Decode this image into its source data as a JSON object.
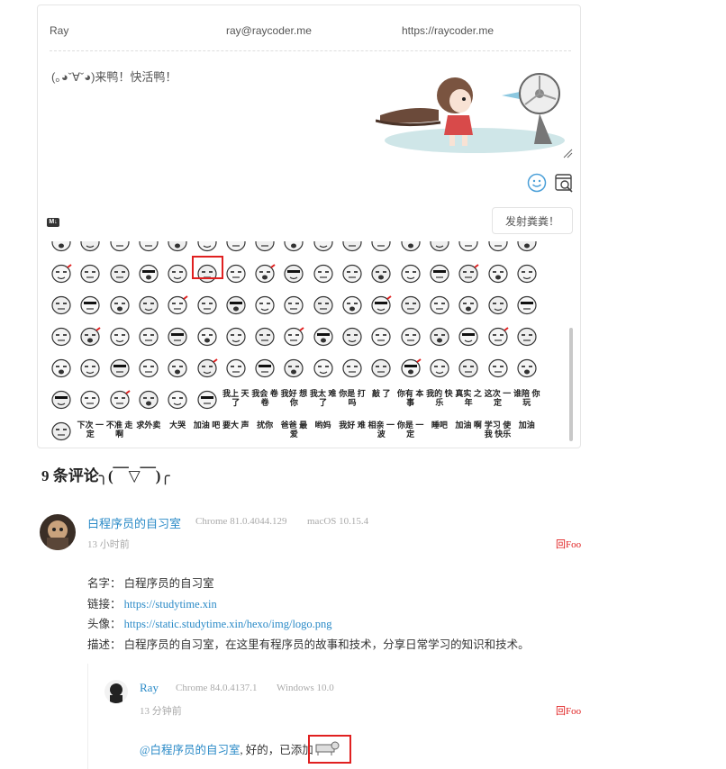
{
  "form": {
    "nick": "Ray",
    "mail": "ray@raycoder.me",
    "link": "https://raycoder.me",
    "content_text": "(｡◕ˇ∀ˇ◕)来鸭！快活鸭！",
    "submit_label": "发射粪粪！",
    "markdown_badge": "M↓"
  },
  "emoji_text_items": [
    "我上\n天了",
    "我会\n卷卷",
    "我好\n想你",
    "我太\n难了",
    "你是\n打吗",
    "敲\n了",
    "你有\n本事",
    "我的\n快乐",
    "真实\n之年",
    "这次\n一定",
    "谁陪\n你玩",
    "下次\n一定",
    "不准\n走啊",
    "求外卖",
    "大哭",
    "加油\n吧",
    "要大\n声",
    "扰你",
    "爸爸\n最爱",
    "哟妈",
    "我好\n难",
    "相亲\n一波",
    "你是\n一定",
    "睡吧",
    "加油\n啊",
    "学习\n使我\n快乐",
    "加油",
    "你说\n不是"
  ],
  "comments": {
    "count_label": "9 条评论╮(￣▽￣)╭",
    "items": [
      {
        "nick": "白程序员的自习室",
        "browser": "Chrome 81.0.4044.129",
        "os": "macOS 10.15.4",
        "time": "13 小时前",
        "reply": "回Foo",
        "lines": [
          {
            "label": "名字：",
            "value": "白程序员的自习室"
          },
          {
            "label": "链接：",
            "value": "https://studytime.xin"
          },
          {
            "label": "头像：",
            "value": "https://static.studytime.xin/hexo/img/logo.png"
          },
          {
            "label": "描述：",
            "value": "白程序员的自习室，在这里有程序员的故事和技术，分享日常学习的知识和技术。"
          }
        ]
      }
    ],
    "reply": {
      "nick": "Ray",
      "browser": "Chrome 84.0.4137.1",
      "os": "Windows 10.0",
      "time": "13 分钟前",
      "reply": "回Foo",
      "mention": "@白程序员的自习室",
      "text": ", 好的，已添加"
    }
  },
  "colors": {
    "accent_blue": "#2a8ac7",
    "reply_red": "#e02020",
    "selection_red": "#e02020"
  }
}
